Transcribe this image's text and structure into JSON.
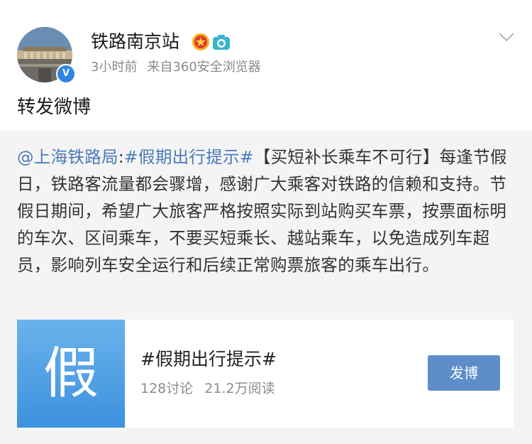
{
  "post": {
    "author": {
      "name": "铁路南京站",
      "avatar_icon": "station-building-avatar",
      "verified_badge": "v-verified-icon",
      "badges": [
        "medal-icon",
        "camera-icon"
      ]
    },
    "time": "3小时前",
    "source": "来自360安全浏览器",
    "repost_text": "转发微博"
  },
  "quoted": {
    "mention": "@上海铁路局",
    "separator": ":",
    "topic": "#假期出行提示#",
    "body": "【买短补长乘车不可行】每逢节假日，铁路客流量都会骤增，感谢广大乘客对铁路的信赖和支持。节假日期间，希望广大旅客严格按照实际到站购买车票，按票面标明的车次、区间乘车，不要买短乘长、越站乘车，以免造成列车超员，影响列车安全运行和后续正常购票旅客的乘车出行。"
  },
  "topic_card": {
    "thumb_char": "假",
    "title": "#假期出行提示#",
    "discussions": "128讨论",
    "reads": "21.2万阅读",
    "button_label": "发博"
  },
  "colors": {
    "link": "#4a7ab9",
    "quoted_bg": "#f4f4f4",
    "button_bg": "#5e8ec9",
    "meta_text": "#8a8a8a"
  }
}
